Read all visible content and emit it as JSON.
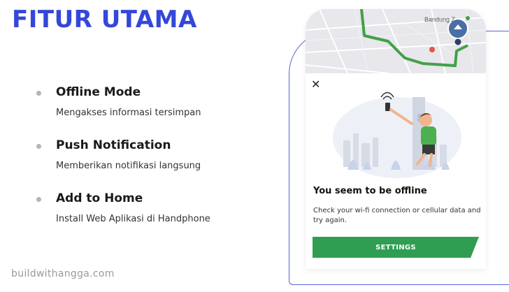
{
  "slide": {
    "title": "FITUR UTAMA"
  },
  "features": [
    {
      "title": "Offline Mode",
      "description": "Mengakses informasi tersimpan"
    },
    {
      "title": "Push Notification",
      "description": "Memberikan notifikasi langsung"
    },
    {
      "title": "Add to Home",
      "description": "Install Web Aplikasi di Handphone"
    }
  ],
  "footer": {
    "brand": "buildwithangga.com"
  },
  "phone": {
    "map": {
      "city_label": "Bandung Z"
    },
    "close_glyph": "✕",
    "offline_title": "You seem to be offline",
    "offline_message": "Check your wi-fi connection or cellular data and try again.",
    "settings_label": "SETTINGS"
  },
  "colors": {
    "title_blue": "#3547d9",
    "settings_green": "#2f9e52",
    "route_green": "#43a047",
    "outline_blue": "#5566d8"
  }
}
